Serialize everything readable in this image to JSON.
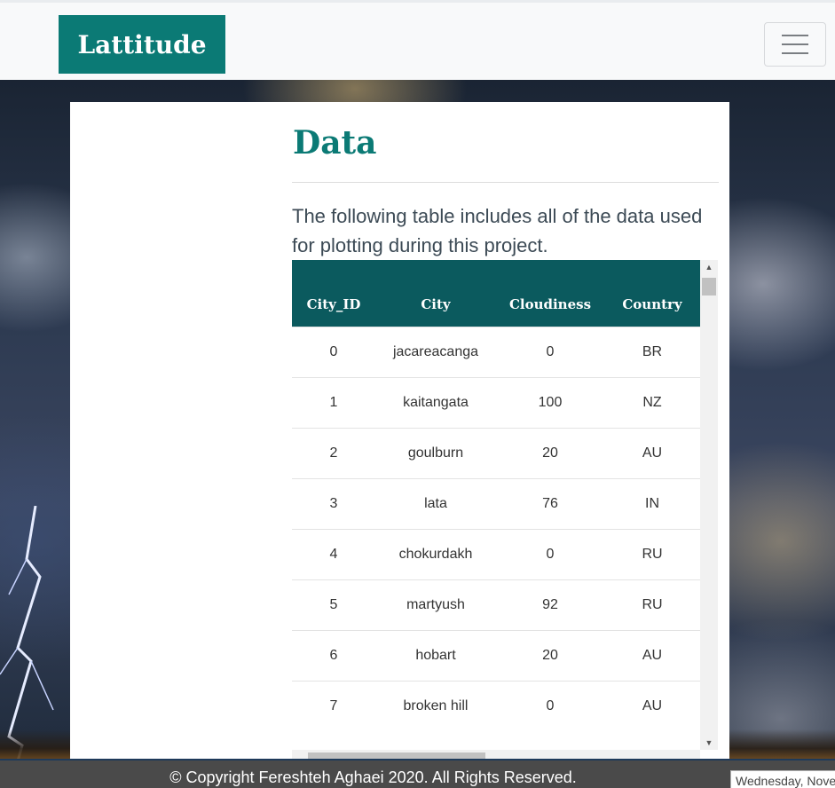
{
  "navbar": {
    "brand": "Lattitude",
    "toggler_icon": "hamburger-menu-icon"
  },
  "content": {
    "title": "Data",
    "description": "The following table includes all of the data used for plotting during this project."
  },
  "table": {
    "headers": [
      "City_ID",
      "City",
      "Cloudiness",
      "Country"
    ],
    "rows": [
      [
        "0",
        "jacareacanga",
        "0",
        "BR"
      ],
      [
        "1",
        "kaitangata",
        "100",
        "NZ"
      ],
      [
        "2",
        "goulburn",
        "20",
        "AU"
      ],
      [
        "3",
        "lata",
        "76",
        "IN"
      ],
      [
        "4",
        "chokurdakh",
        "0",
        "RU"
      ],
      [
        "5",
        "martyush",
        "92",
        "RU"
      ],
      [
        "6",
        "hobart",
        "20",
        "AU"
      ],
      [
        "7",
        "broken hill",
        "0",
        "AU"
      ]
    ]
  },
  "footer": {
    "text": "© Copyright Fereshteh Aghaei 2020. All Rights Reserved."
  },
  "taskbar": {
    "date_tooltip": "Wednesday, Nove"
  },
  "colors": {
    "brand": "#0b7a75",
    "table_header": "#0b5a5e"
  }
}
